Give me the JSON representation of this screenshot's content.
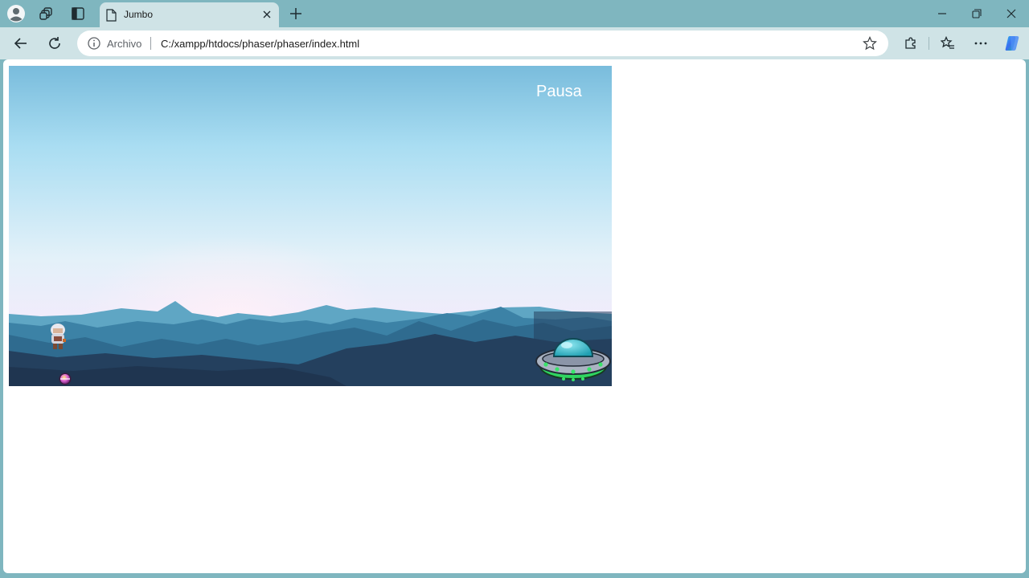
{
  "browser": {
    "tab": {
      "title": "Jumbo"
    },
    "address": {
      "security_label": "Archivo",
      "url": "C:/xampp/htdocs/phaser/phaser/index.html"
    },
    "icons": {
      "profile": "profile-avatar-icon",
      "workspaces": "workspaces-icon",
      "tab_actions": "vertical-tabs-icon",
      "new_tab": "plus-icon",
      "minimize": "minimize-icon",
      "restore": "restore-icon",
      "close": "close-icon",
      "back": "arrow-left-icon",
      "refresh": "refresh-icon",
      "info": "info-icon",
      "favorite": "star-icon",
      "extensions": "puzzle-icon",
      "favorites": "favorites-icon",
      "more": "ellipsis-icon",
      "copilot": "copilot-icon"
    }
  },
  "game": {
    "pause_label": "Pausa",
    "sprites": [
      "player-character",
      "bomb-orb",
      "ufo-enemy"
    ]
  },
  "colors": {
    "chrome": "#7fb6bf",
    "toolbar": "#cfe3e6",
    "sky_top": "#79bcdc",
    "sky_bottom": "#e9f2fb",
    "mountains_far": "#5fa6c4",
    "mountains_mid": "#2f6b8f",
    "mountains_near": "#223a55",
    "ufo_dome": "#35b5c4",
    "ufo_lights": "#39e36a"
  }
}
